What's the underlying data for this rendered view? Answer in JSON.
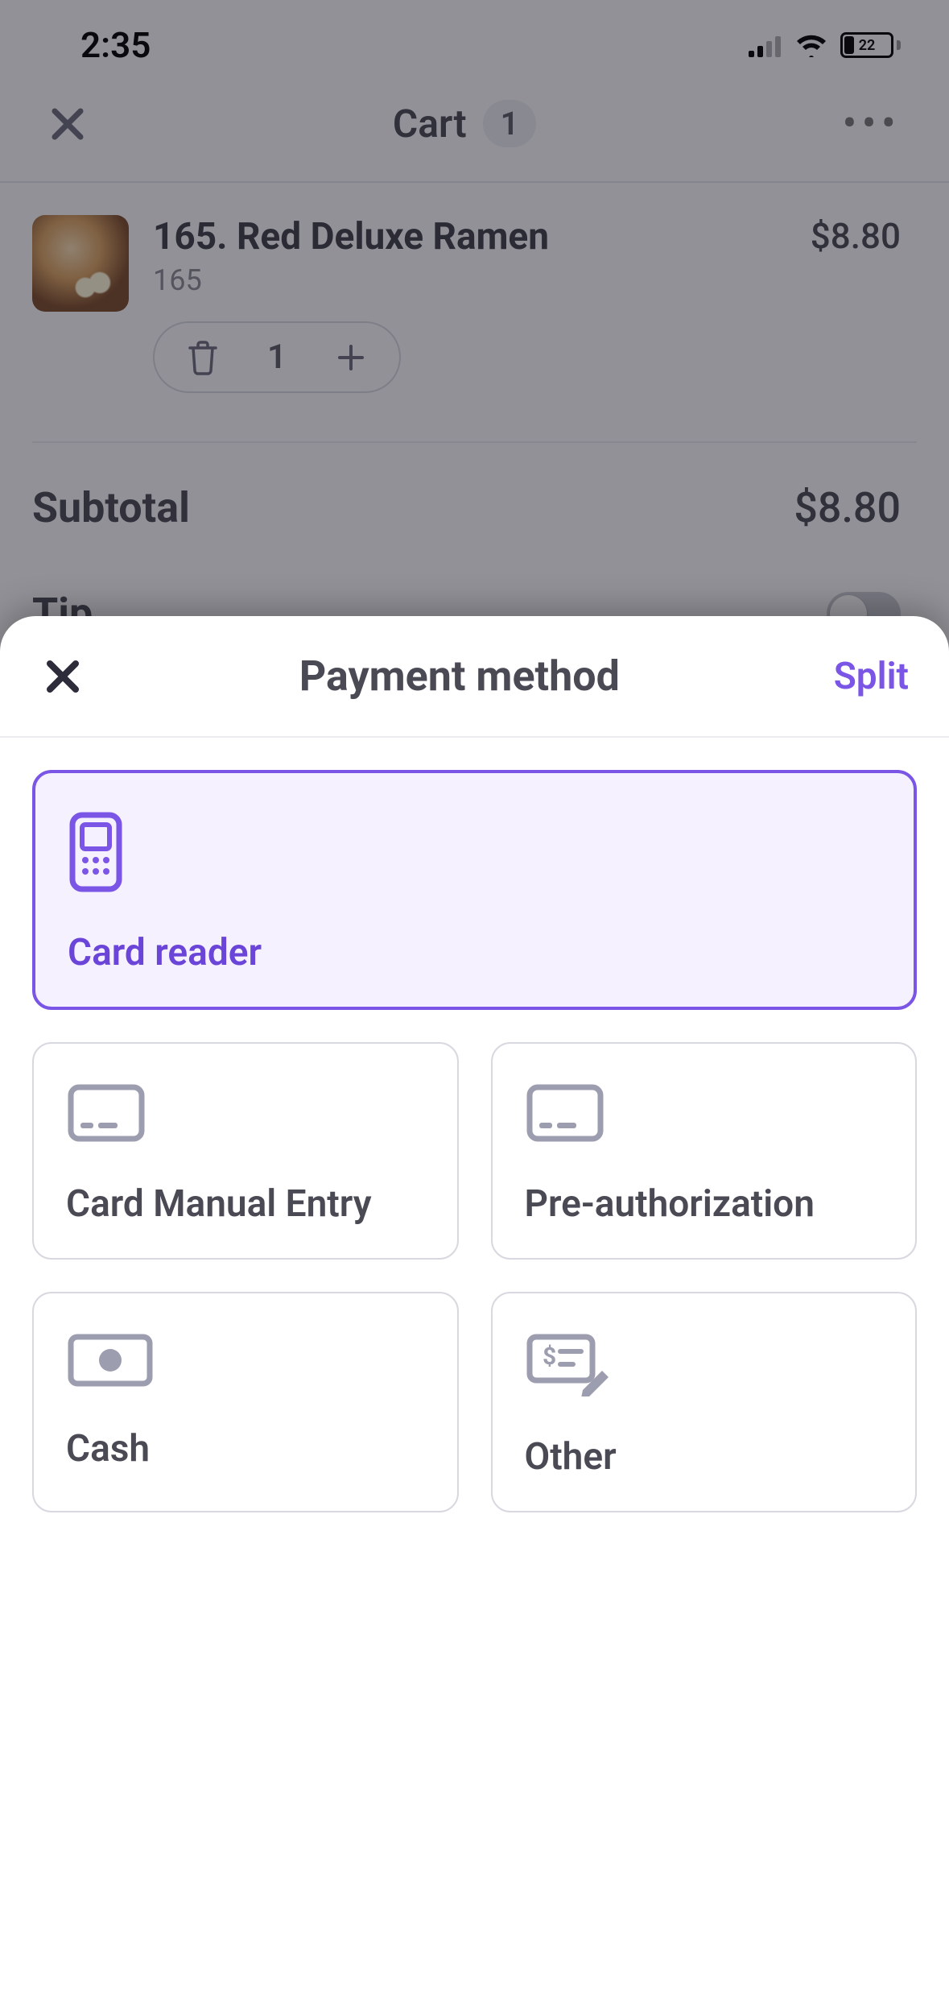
{
  "status": {
    "time": "2:35",
    "battery": "22"
  },
  "header": {
    "title": "Cart",
    "badge": "1"
  },
  "cart": {
    "item": {
      "title": "165. Red Deluxe Ramen",
      "code": "165",
      "price": "$8.80",
      "qty": "1"
    },
    "subtotal_label": "Subtotal",
    "subtotal_value": "$8.80",
    "tip_label": "Tip"
  },
  "sheet": {
    "title": "Payment method",
    "split": "Split",
    "options": {
      "card_reader": "Card reader",
      "manual": "Card Manual Entry",
      "preauth": "Pre-authorization",
      "cash": "Cash",
      "other": "Other"
    }
  }
}
